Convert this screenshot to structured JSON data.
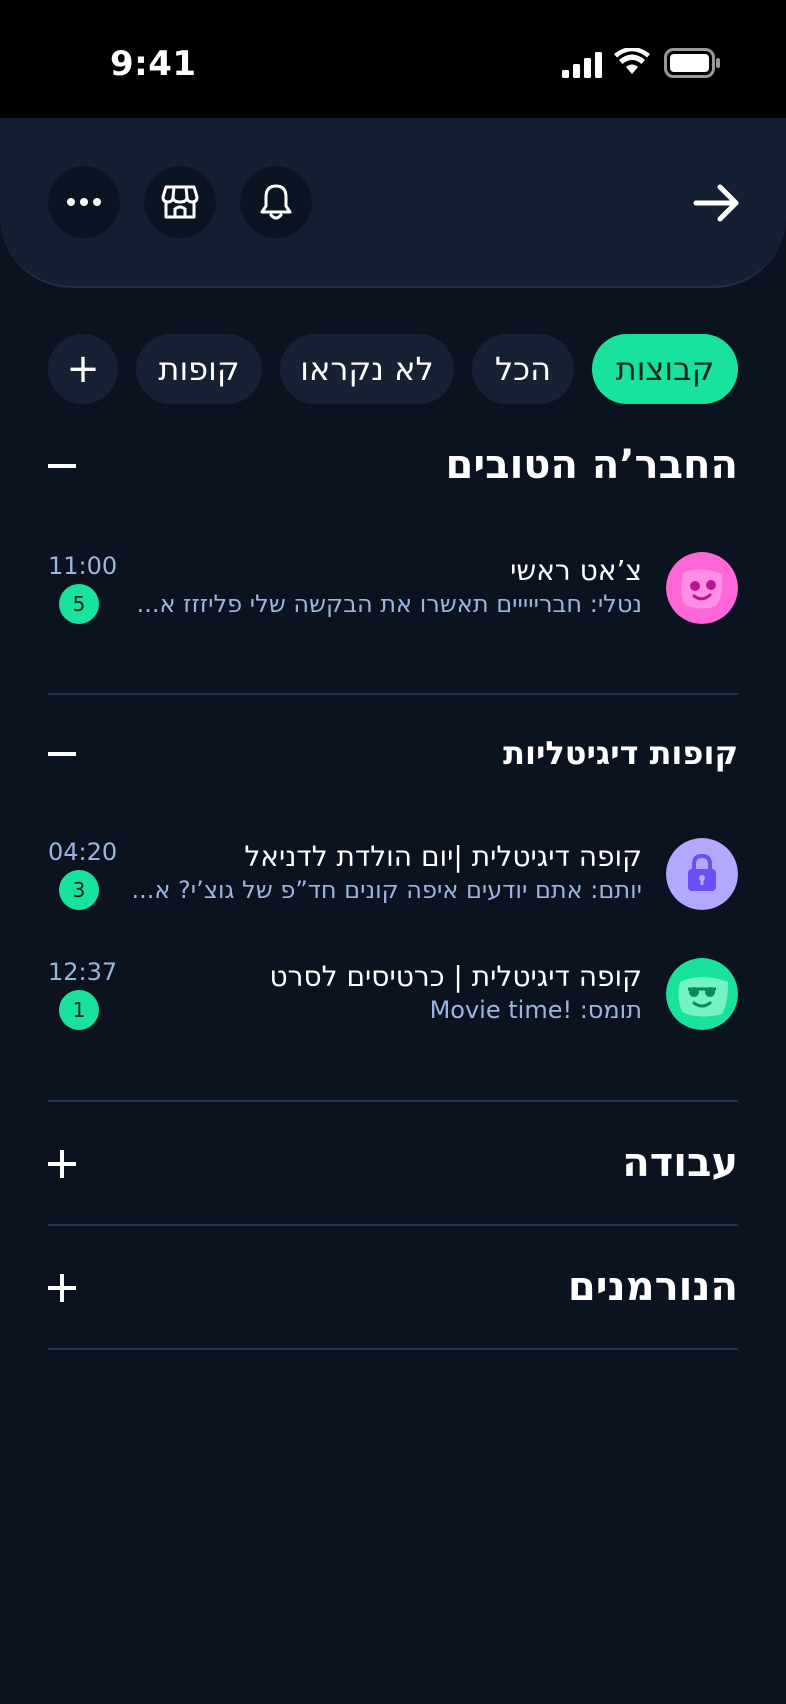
{
  "status_bar": {
    "time": "9:41"
  },
  "header": {
    "icons": [
      "more-icon",
      "store-icon",
      "bell-icon",
      "arrow-right-icon"
    ]
  },
  "chips": {
    "groups": "קבוצות",
    "all": "הכל",
    "unread": "לא נקראו",
    "funds": "קופות",
    "add": "+"
  },
  "sections": {
    "good_friends": {
      "title": "החבר’ה הטובים",
      "chats": [
        {
          "name": "צ’אט ראשי",
          "preview": "נטלי: חברייייים תאשרו את הבקשה שלי פליזזז א...",
          "time": "11:00",
          "unread": "5"
        }
      ]
    },
    "digital_funds": {
      "title": "קופות דיגיטליות",
      "chats": [
        {
          "name": "קופה דיגיטלית |יום הולדת לדניאל",
          "preview": "יותם: אתם יודעים איפה קונים חד”פ של גוצ’י? א...",
          "time": "04:20",
          "unread": "3"
        },
        {
          "name": "קופה דיגיטלית | כרטיסים לסרט",
          "preview": "תומס: !Movie time",
          "time": "12:37",
          "unread": "1"
        }
      ]
    },
    "work": {
      "title": "עבודה"
    },
    "normies": {
      "title": "הנורמנים"
    }
  },
  "colors": {
    "accent": "#18e29c",
    "background": "#0b1220",
    "header": "#132032",
    "chip": "#162233",
    "preview_text": "#9bb6de",
    "avatar_pink": "#ff66d8",
    "avatar_purple": "#b3a8ff",
    "avatar_green": "#18e29c"
  }
}
